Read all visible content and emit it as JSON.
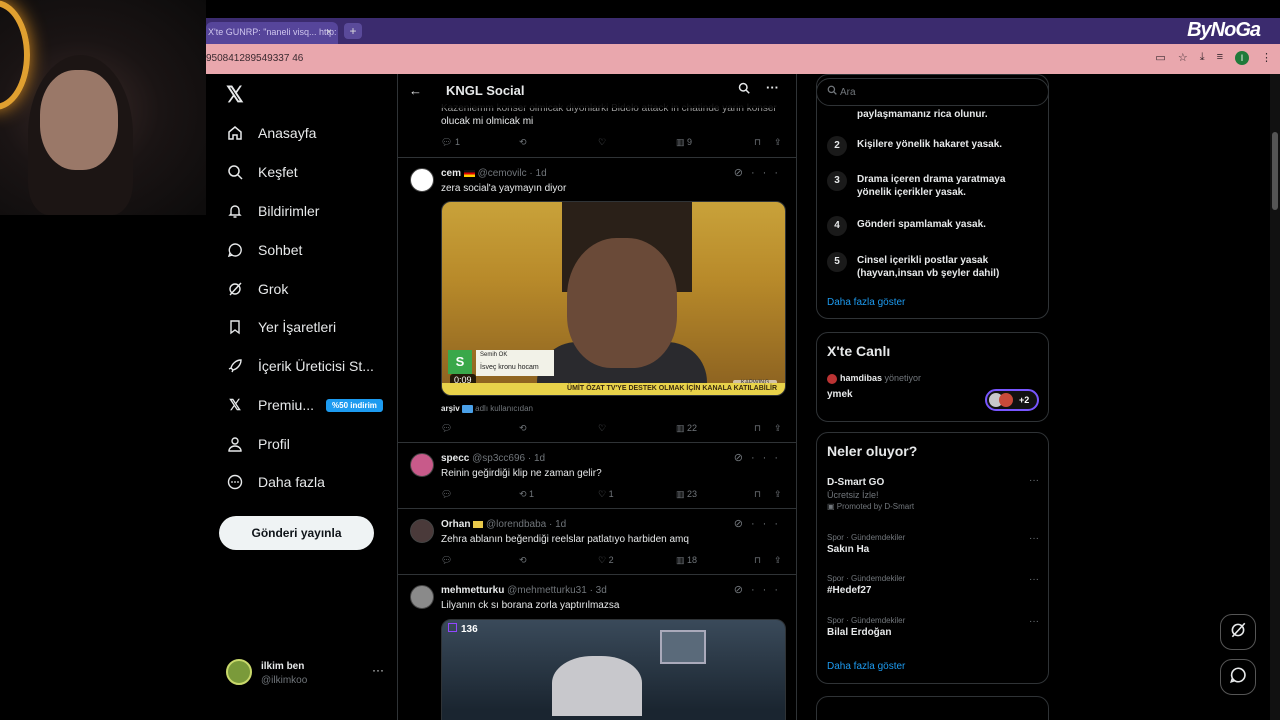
{
  "browser": {
    "tab_title": "X'te GUNRP: \"naneli visq... http:",
    "tab_close": "×",
    "new_tab": "+",
    "url": "950841289549337 46",
    "brand": "ByNoGa"
  },
  "nav": {
    "logo": "𝕏",
    "items": [
      {
        "label": "Anasayfa",
        "icon": "home-icon"
      },
      {
        "label": "Keşfet",
        "icon": "search-icon"
      },
      {
        "label": "Bildirimler",
        "icon": "bell-icon"
      },
      {
        "label": "Sohbet",
        "icon": "chat-icon"
      },
      {
        "label": "Grok",
        "icon": "grok-icon"
      },
      {
        "label": "Yer İşaretleri",
        "icon": "bookmark-icon"
      },
      {
        "label": "İçerik Üreticisi St...",
        "icon": "rocket-icon"
      },
      {
        "label": "Premiu...",
        "icon": "x-icon",
        "badge": "%50 indirim"
      },
      {
        "label": "Profil",
        "icon": "person-icon"
      },
      {
        "label": "Daha fazla",
        "icon": "more-circle-icon"
      }
    ],
    "post_button": "Gönderi yayınla",
    "account": {
      "name": "ilkim ben",
      "handle": "@ilkimkoo",
      "more": "···"
    }
  },
  "feed": {
    "title": "KNGL Social",
    "posts": [
      {
        "text": "olucak mi olmicak mi",
        "partial_text": "Kazeniemm konser olmicak diyonlarki Bidelo attack in chatinde yarin konser",
        "actions": {
          "reply": "1",
          "repost": "",
          "like": "",
          "views": "9"
        }
      },
      {
        "name": "cem",
        "handle": "@cemovilc",
        "time": "· 1d",
        "text": "zera social'a yaymayın diyor",
        "media": {
          "duration": "0:09",
          "chip": "S",
          "lower_name": "Semih OK",
          "lower_text": "İsveç kronu hocam",
          "banner": "ÜMİT ÖZAT TV'YE DESTEK OLMAK İÇİN KANALA KATILABİLİR",
          "watermark": "KAPWING"
        },
        "footnote_name": "arşiv",
        "footnote_text": "adlı kullanıcıdan",
        "actions": {
          "reply": "",
          "repost": "",
          "like": "",
          "views": "22"
        }
      },
      {
        "name": "specc",
        "handle": "@sp3cc696",
        "time": "· 1d",
        "text": "Reinin geğirdiği klip ne zaman gelir?",
        "actions": {
          "reply": "",
          "repost": "1",
          "like": "1",
          "views": "23"
        }
      },
      {
        "name": "Orhan",
        "handle": "@lorendbaba",
        "time": "· 1d",
        "text": "Zehra ablanın beğendiği reelslar patlatıyo harbiden amq",
        "actions": {
          "reply": "",
          "repost": "",
          "like": "2",
          "views": "18"
        }
      },
      {
        "name": "mehmetturku",
        "handle": "@mehmetturku31",
        "time": "· 3d",
        "text": "Lilyanın ck sı borana zorla yaptırılmazsa",
        "media": {
          "viewers": "136"
        }
      }
    ]
  },
  "sidebar": {
    "search_placeholder": "Ara",
    "rules_partial": "paylaşmamanız rica olunur.",
    "rules": [
      {
        "num": "2",
        "text": "Kişilere yönelik hakaret yasak."
      },
      {
        "num": "3",
        "text": "Drama içeren drama yaratmaya yönelik içerikler yasak."
      },
      {
        "num": "4",
        "text": "Gönderi spamlamak yasak."
      },
      {
        "num": "5",
        "text": "Cinsel içerikli postlar yasak (hayvan,insan vb şeyler dahil)"
      }
    ],
    "rules_more": "Daha fazla göster",
    "live": {
      "title": "X'te Canlı",
      "host": "hamdibas",
      "host_suffix": "yönetiyor",
      "name": "ymek",
      "extra": "+2"
    },
    "trends": {
      "title": "Neler oluyor?",
      "items": [
        {
          "category": "",
          "name": "D-Smart GO",
          "sub": "Ücretsiz İzle!",
          "promo": "Promoted by D-Smart"
        },
        {
          "category": "Spor · Gündemdekiler",
          "name": "Sakın Ha"
        },
        {
          "category": "Spor · Gündemdekiler",
          "name": "#Hedef27"
        },
        {
          "category": "Spor · Gündemdekiler",
          "name": "Bilal Erdoğan"
        }
      ],
      "more": "Daha fazla göster"
    }
  }
}
